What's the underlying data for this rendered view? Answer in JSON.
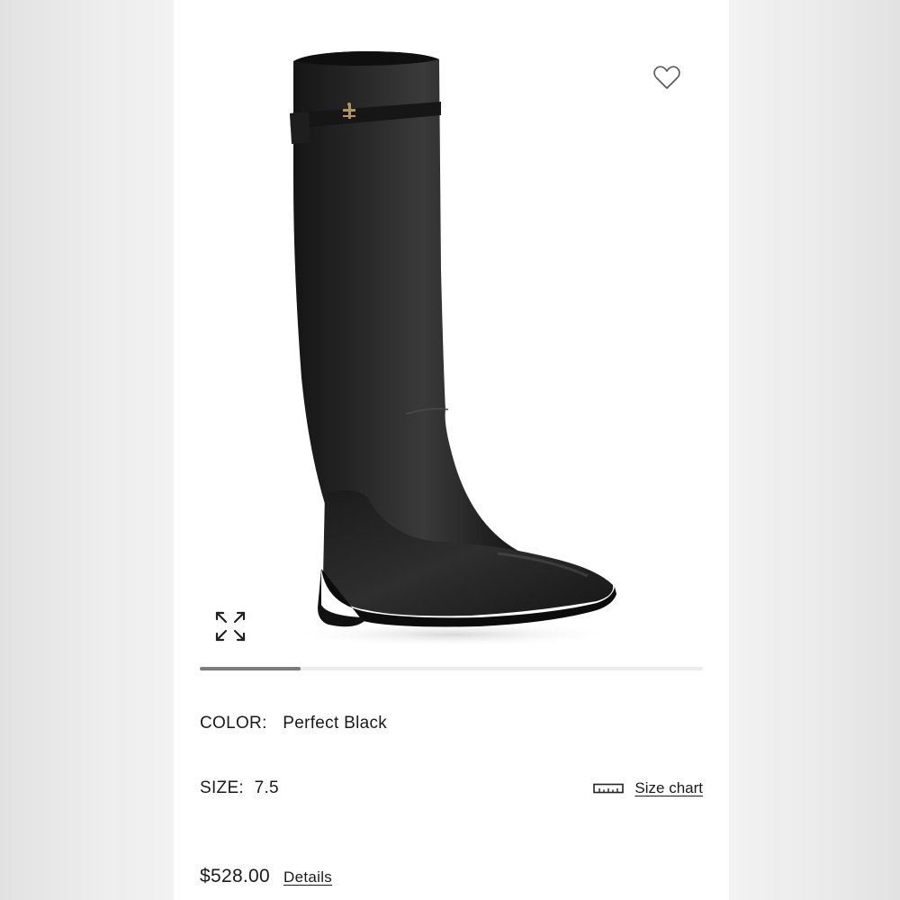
{
  "product": {
    "image_alt": "Black leather knee-high riding boot",
    "carousel_progress": 0.2
  },
  "color": {
    "label": "COLOR:",
    "value": "Perfect Black"
  },
  "size": {
    "label": "SIZE:",
    "value": "7.5",
    "chart_link": "Size chart"
  },
  "price": {
    "value": "$528.00",
    "details_link": "Details"
  },
  "icons": {
    "wishlist": "heart-icon",
    "expand": "expand-arrows-icon",
    "ruler": "ruler-icon"
  },
  "colors": {
    "boot": "#1f1f1f",
    "progress": "#7b7b7b",
    "track": "#ececec",
    "hardware": "#b8954a"
  }
}
